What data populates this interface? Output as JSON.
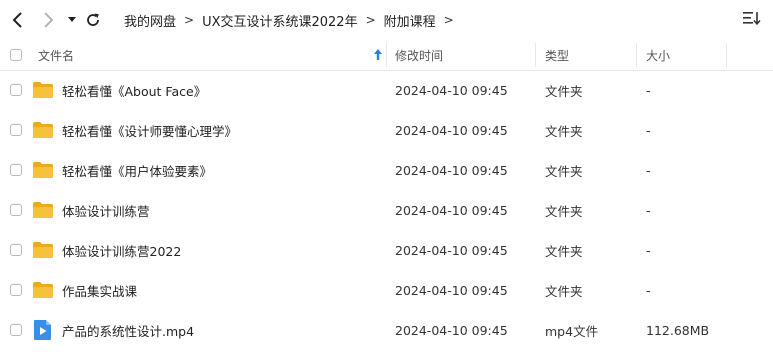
{
  "breadcrumb": [
    {
      "label": "我的网盘"
    },
    {
      "label": "UX交互设计系统课2022年"
    },
    {
      "label": "附加课程"
    }
  ],
  "breadcrumb_separator": ">",
  "columns": {
    "name": "文件名",
    "modified": "修改时间",
    "type": "类型",
    "size": "大小"
  },
  "sort": {
    "column": "name",
    "direction": "ascending",
    "icon": "arrow-up-icon"
  },
  "files": [
    {
      "name": "轻松看懂《About Face》",
      "modified": "2024-04-10 09:45",
      "type": "文件夹",
      "size": "-",
      "icon": "folder-icon"
    },
    {
      "name": "轻松看懂《设计师要懂心理学》",
      "modified": "2024-04-10 09:45",
      "type": "文件夹",
      "size": "-",
      "icon": "folder-icon"
    },
    {
      "name": "轻松看懂《用户体验要素》",
      "modified": "2024-04-10 09:45",
      "type": "文件夹",
      "size": "-",
      "icon": "folder-icon"
    },
    {
      "name": "体验设计训练营",
      "modified": "2024-04-10 09:45",
      "type": "文件夹",
      "size": "-",
      "icon": "folder-icon"
    },
    {
      "name": "体验设计训练营2022",
      "modified": "2024-04-10 09:45",
      "type": "文件夹",
      "size": "-",
      "icon": "folder-icon"
    },
    {
      "name": "作品集实战课",
      "modified": "2024-04-10 09:45",
      "type": "文件夹",
      "size": "-",
      "icon": "folder-icon"
    },
    {
      "name": "产品的系统性设计.mp4",
      "modified": "2024-04-10 09:45",
      "type": "mp4文件",
      "size": "112.68MB",
      "icon": "video-icon"
    }
  ],
  "colors": {
    "folder": "#f5c33b",
    "folder_back": "#e9ac1f",
    "video": "#3a8ee6",
    "sort_arrow": "#2b7de9"
  }
}
